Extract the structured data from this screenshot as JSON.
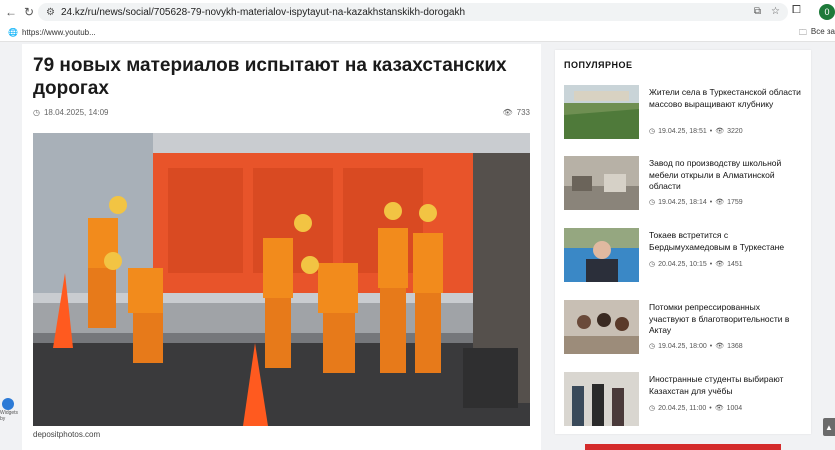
{
  "browser": {
    "url": "24.kz/ru/news/social/705628-79-novykh-materialov-ispytayut-na-kazakhstanskikh-dorogakh",
    "bookmark": "https://www.youtub...",
    "bookmarks_right": "Все за",
    "profile_initial": "0"
  },
  "article": {
    "title": "79 новых материалов испытают на казахстанских дорогах",
    "date": "18.04.2025, 14:09",
    "views": "733",
    "photo_credit": "depositphotos.com"
  },
  "sidebar": {
    "heading": "ПОПУЛЯРНОЕ",
    "items": [
      {
        "title": "Жители села в Туркестанской области массово выращивают клубнику",
        "date": "19.04.25, 18:51",
        "views": "3220"
      },
      {
        "title": "Завод по производству школьной мебели открыли в Алматинской области",
        "date": "19.04.25, 18:14",
        "views": "1759"
      },
      {
        "title": "Токаев встретится с Бердымухамедовым в Туркестане",
        "date": "20.04.25, 10:15",
        "views": "1451"
      },
      {
        "title": "Потомки репрессированных участвуют в благотворительности в Актау",
        "date": "19.04.25, 18:00",
        "views": "1368"
      },
      {
        "title": "Иностранные студенты выбирают Казахстан для учёбы",
        "date": "20.04.25, 11:00",
        "views": "1004"
      }
    ]
  },
  "widgets": {
    "left_float_text": "Widgets by"
  },
  "colors": {
    "accent_blue": "#2d7bd6",
    "truck_orange": "#e8542a",
    "banner_red": "#d42b2b"
  }
}
